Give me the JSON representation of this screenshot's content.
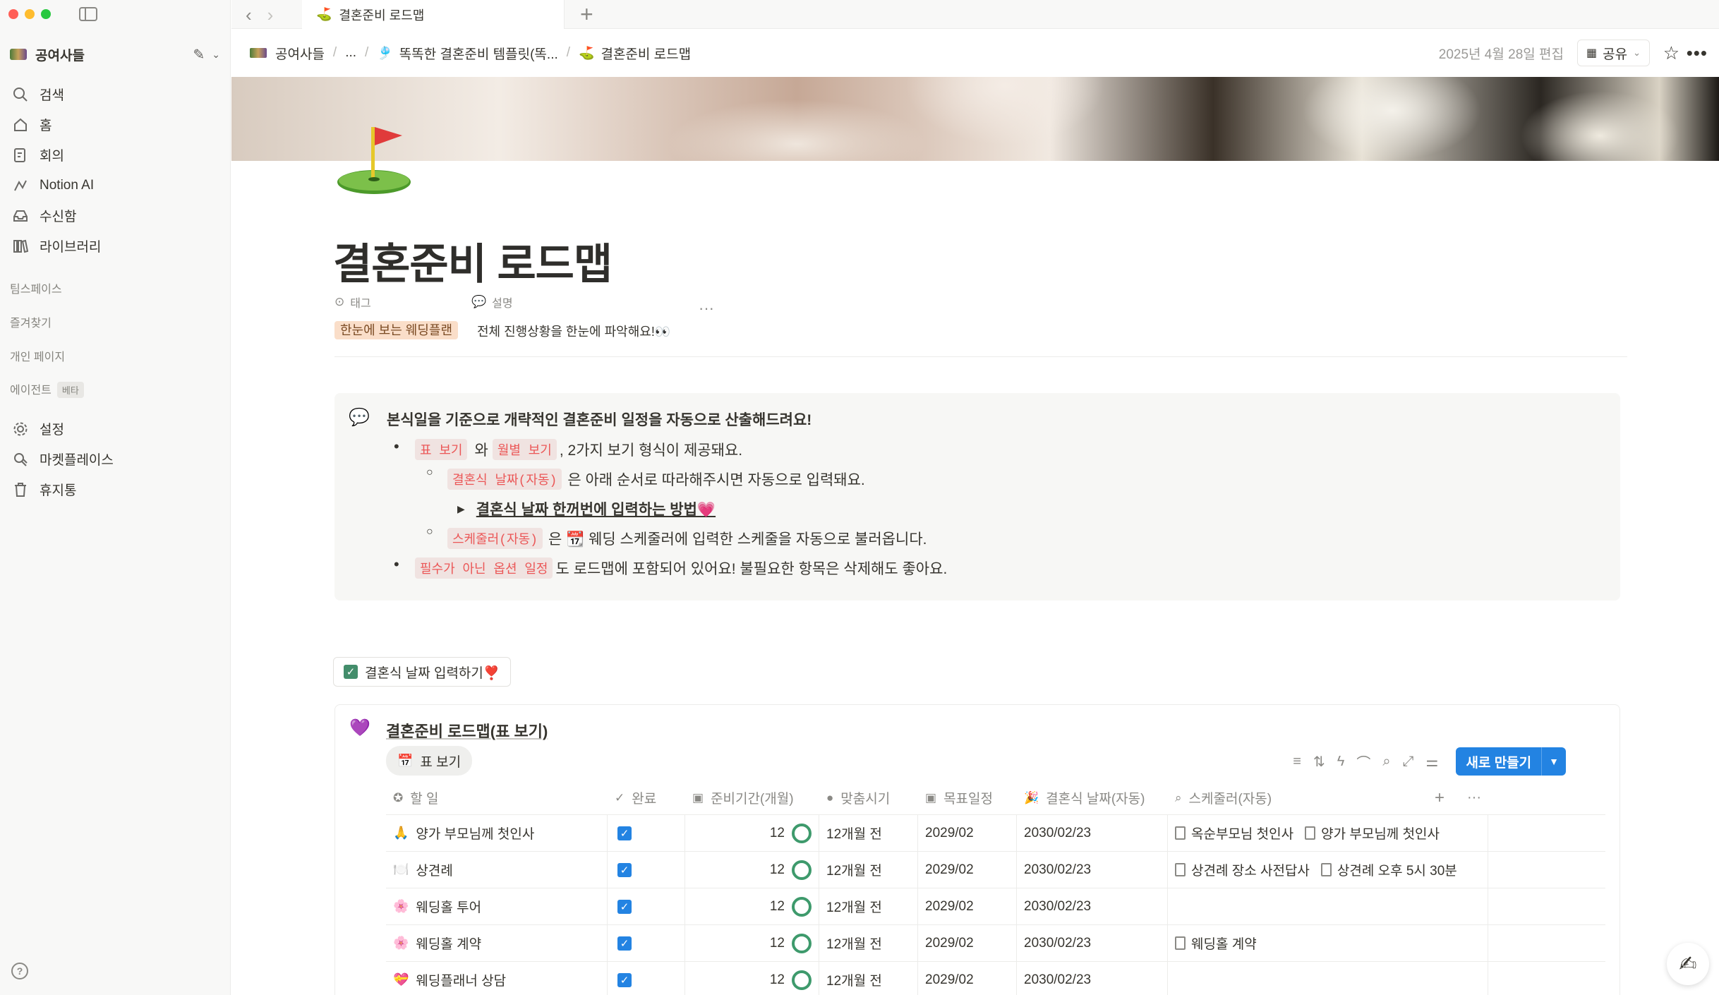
{
  "window": {
    "tab_title": "결혼준비 로드맵",
    "tab_emoji": "⛳"
  },
  "sidebar": {
    "workspace": "공여사들",
    "nav": [
      {
        "label": "검색",
        "icon": "search-icon"
      },
      {
        "label": "홈",
        "icon": "home-icon"
      },
      {
        "label": "회의",
        "icon": "meeting-icon"
      },
      {
        "label": "Notion AI",
        "icon": "notion-ai-icon"
      },
      {
        "label": "수신함",
        "icon": "inbox-icon"
      },
      {
        "label": "라이브러리",
        "icon": "library-icon"
      }
    ],
    "sections": {
      "teamspace": "팀스페이스",
      "favorites": "즐겨찾기",
      "private": "개인 페이지",
      "agents": "에이전트",
      "beta": "베타"
    },
    "nav2": [
      {
        "label": "설정",
        "icon": "gear-icon"
      },
      {
        "label": "마켓플레이스",
        "icon": "marketplace-icon"
      },
      {
        "label": "휴지통",
        "icon": "trash-icon"
      }
    ],
    "help": "?"
  },
  "topbar": {
    "crumbs": [
      "공여사들",
      "...",
      "똑똑한 결혼준비 템플릿(똑...",
      "결혼준비 로드맵"
    ],
    "edited": "2025년 4월 28일 편집",
    "share": "공유"
  },
  "page": {
    "title": "결혼준비 로드맵",
    "prop_tag_label": "태그",
    "prop_desc_label": "설명",
    "tag_value": "한눈에 보는 웨딩플랜",
    "desc_value": "전체 진행상황을 한눈에 파악해요!👀"
  },
  "callout": {
    "heading": "본식일을 기준으로 개략적인 결혼준비 일정을 자동으로 산출해드려요!",
    "b1_code1": "표 보기",
    "b1_mid": "와",
    "b1_code2": "월별 보기",
    "b1_tail": ", 2가지 보기 형식이 제공돼요.",
    "b2_code": "결혼식 날짜(자동)",
    "b2_tail": "은 아래 순서로 따라해주시면 자동으로 입력돼요.",
    "toggle": "결혼식 날짜 한꺼번에 입력하는 방법💗",
    "b3_code": "스케줄러(자동)",
    "b3_tail": "은 📆 웨딩 스케줄러에 입력한 스케줄을 자동으로 불러옵니다.",
    "b4_code": "필수가 아닌 옵션 일정",
    "b4_tail": "도 로드맵에 포함되어 있어요! 불필요한 항목은 삭제해도 좋아요."
  },
  "button": {
    "label": "결혼식 날짜 입력하기❣️"
  },
  "database": {
    "title": "결혼준비 로드맵(표 보기)",
    "view": "표 보기",
    "new_button": "새로 만들기",
    "columns": [
      "할 일",
      "완료",
      "준비기간(개월)",
      "맞춤시기",
      "목표일정",
      "결혼식 날짜(자동)",
      "스케줄러(자동)"
    ],
    "rows": [
      {
        "emoji": "🙏",
        "task": "양가 부모님께 첫인사",
        "done": true,
        "months": "12",
        "timing": "12개월 전",
        "target": "2029/02",
        "wedding": "2030/02/23",
        "files": [
          "옥순부모님 첫인사",
          "양가 부모님께 첫인사"
        ]
      },
      {
        "emoji": "🍽️",
        "task": "상견례",
        "done": true,
        "months": "12",
        "timing": "12개월 전",
        "target": "2029/02",
        "wedding": "2030/02/23",
        "files": [
          "상견례 장소 사전답사",
          "상견례 오후 5시 30분"
        ]
      },
      {
        "emoji": "🌸",
        "task": "웨딩홀 투어",
        "done": true,
        "months": "12",
        "timing": "12개월 전",
        "target": "2029/02",
        "wedding": "2030/02/23",
        "files": []
      },
      {
        "emoji": "🌸",
        "task": "웨딩홀 계약",
        "done": true,
        "months": "12",
        "timing": "12개월 전",
        "target": "2029/02",
        "wedding": "2030/02/23",
        "files": [
          "웨딩홀 계약"
        ]
      },
      {
        "emoji": "💝",
        "task": "웨딩플래너 상담",
        "done": true,
        "months": "12",
        "timing": "12개월 전",
        "target": "2029/02",
        "wedding": "2030/02/23",
        "files": []
      }
    ]
  }
}
